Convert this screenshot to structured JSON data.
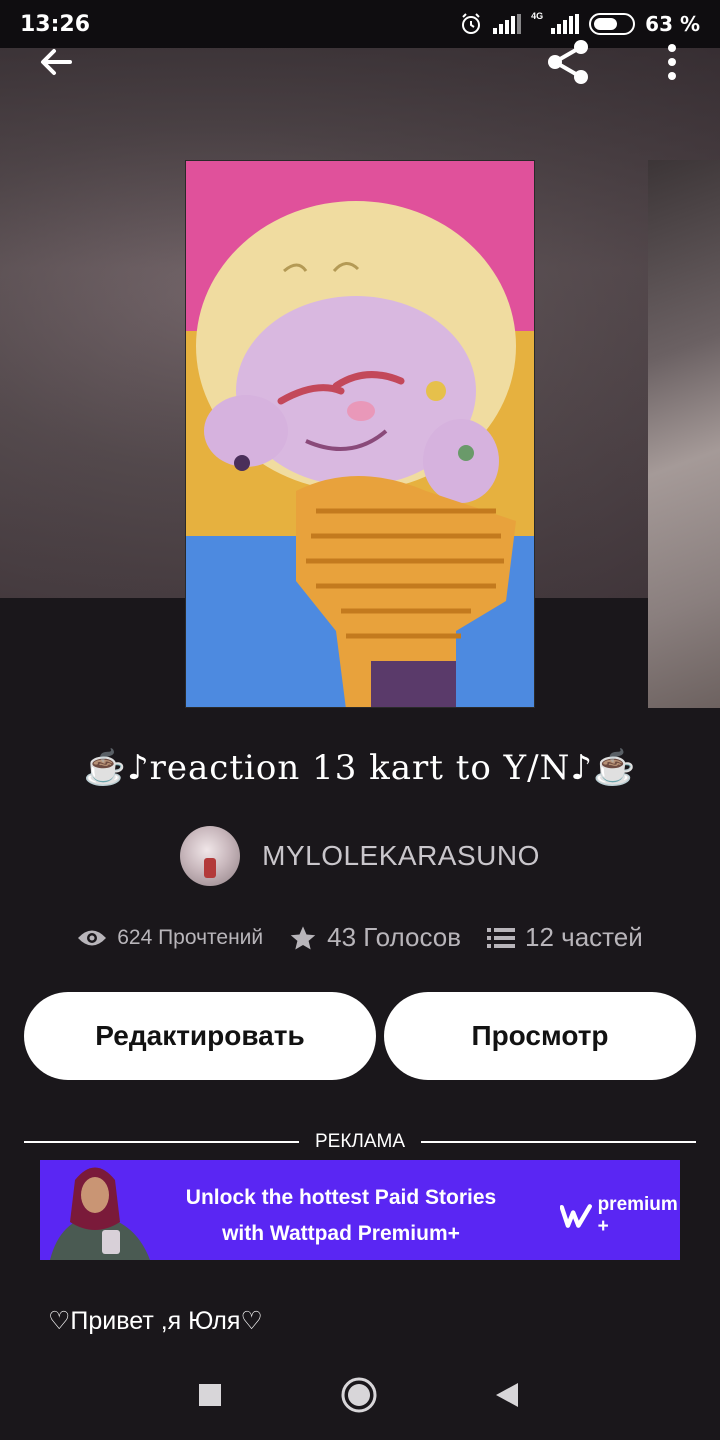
{
  "status_bar": {
    "time": "13:26",
    "network_tag": "4G",
    "battery_text": "63 %",
    "battery_level": 0.63,
    "icons": [
      "alarm-icon",
      "signal-icon",
      "signal-4g-icon",
      "battery-icon"
    ]
  },
  "toolbar": {
    "icons": [
      "back-arrow-icon",
      "share-icon",
      "more-vertical-icon"
    ]
  },
  "story": {
    "title": "☕♪reaction 13 kart to Y/N♪☕",
    "author": "MYLOLEKARASUNO",
    "reads": "624 Прочтений",
    "votes": "43 Голосов",
    "parts": "12 частей",
    "description": "♡Привет ,я Юля♡"
  },
  "actions": {
    "edit_label": "Редактировать",
    "view_label": "Просмотр"
  },
  "ad": {
    "label": "РЕКЛАМА",
    "line1": "Unlock the hottest Paid Stories",
    "line2": "with Wattpad Premium+",
    "brand": "premium +",
    "brand_mark": "W"
  },
  "colors": {
    "background": "#1a171b",
    "ad_purple": "#5a26f3",
    "cover_pink": "#e0519b",
    "cover_yellow": "#e6b13f",
    "cover_blue": "#4d8ae0",
    "button_bg": "#ffffff"
  },
  "nav": {
    "icons": [
      "recent-apps-icon",
      "home-icon",
      "back-icon"
    ]
  }
}
